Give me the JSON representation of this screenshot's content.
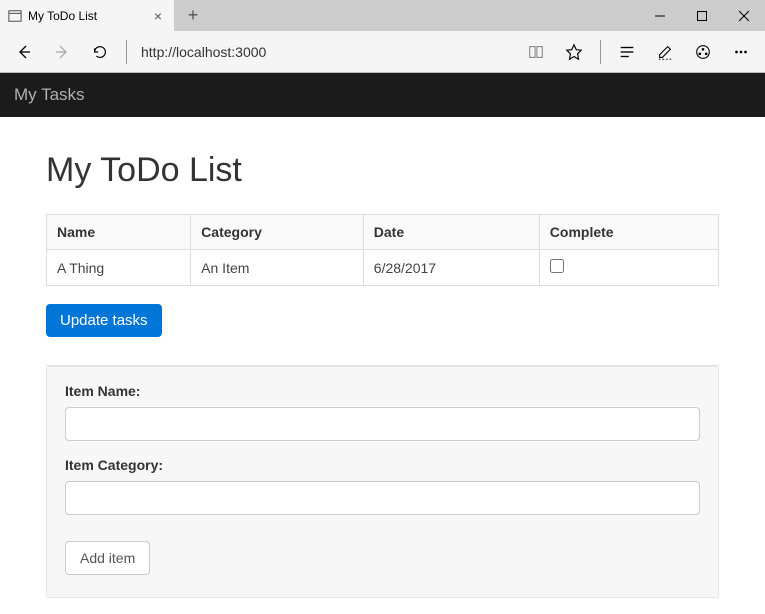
{
  "browser": {
    "tab_title": "My ToDo List",
    "url": "http://localhost:3000"
  },
  "navbar": {
    "brand": "My Tasks"
  },
  "page": {
    "heading": "My ToDo List"
  },
  "table": {
    "headers": [
      "Name",
      "Category",
      "Date",
      "Complete"
    ],
    "rows": [
      {
        "name": "A Thing",
        "category": "An Item",
        "date": "6/28/2017",
        "complete": false
      }
    ]
  },
  "buttons": {
    "update_tasks": "Update tasks",
    "add_item": "Add item"
  },
  "form": {
    "item_name_label": "Item Name:",
    "item_category_label": "Item Category:",
    "item_name_value": "",
    "item_category_value": ""
  }
}
